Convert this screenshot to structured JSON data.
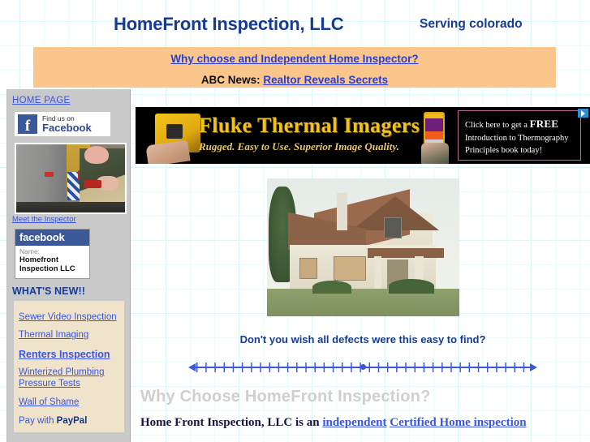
{
  "header": {
    "site_title": "HomeFront Inspection, LLC",
    "serving": "Serving colorado"
  },
  "promo": {
    "link1": "Why choose and Independent Home Inspector?",
    "abc_label": "ABC News:",
    "link2": "Realtor Reveals Secrets"
  },
  "sidebar": {
    "home_page": "HOME PAGE",
    "facebook_badge": {
      "small": "Find us on",
      "big": "Facebook",
      "logo_letter": "f"
    },
    "meet_inspector": "Meet the Inspector",
    "fb_widget": {
      "head": "facebook",
      "name_label": "Name:",
      "name_value": "Homefront Inspection LLC"
    },
    "whats_new_title": "WHAT'S NEW!!",
    "news_links": [
      {
        "label": "Sewer Video Inspection",
        "bold": false
      },
      {
        "label": "Thermal Imaging",
        "bold": false
      },
      {
        "label": "Renters Inspection",
        "bold": true
      },
      {
        "label": "Winterized Plumbing Pressure Tests",
        "bold": false
      },
      {
        "label": "Wall of Shame",
        "bold": false
      }
    ],
    "paypal_prefix": "Pay with ",
    "paypal_brand": "PayPal"
  },
  "fluke_ad": {
    "title": "Fluke Thermal Imagers",
    "subtitle": "Rugged. Easy to Use. Superior Image Quality.",
    "cta_line1_pre": "Click here to get a ",
    "cta_free": "FREE",
    "cta_line2": "Introduction to Thermography",
    "cta_line3": "Principles book today!",
    "ad_choices_icon": "adchoices-triangle-icon"
  },
  "house": {
    "caption": "Don't you wish all defects were this easy to find?",
    "alt": "Dilapidated boarded-up tudor style house with damaged roof"
  },
  "content": {
    "why_heading": "Why Choose HomeFront Inspection?",
    "para_part1": "Home Front Inspection, LLC is an ",
    "para_link1": "independent",
    "para_space": " ",
    "para_link2": "Certified Home inspection"
  },
  "colors": {
    "title_blue": "#173a93",
    "link_blue": "#3b55dd",
    "promo_orange": "#fbc68c",
    "sidebar_gray": "#c9c9c9",
    "news_panel_tan": "#efe3cc",
    "grid_line": "#eefbfb",
    "heading_gray": "#cfcfcf",
    "facebook_blue": "#3b5998",
    "fluke_gold": "#f2c21c"
  }
}
